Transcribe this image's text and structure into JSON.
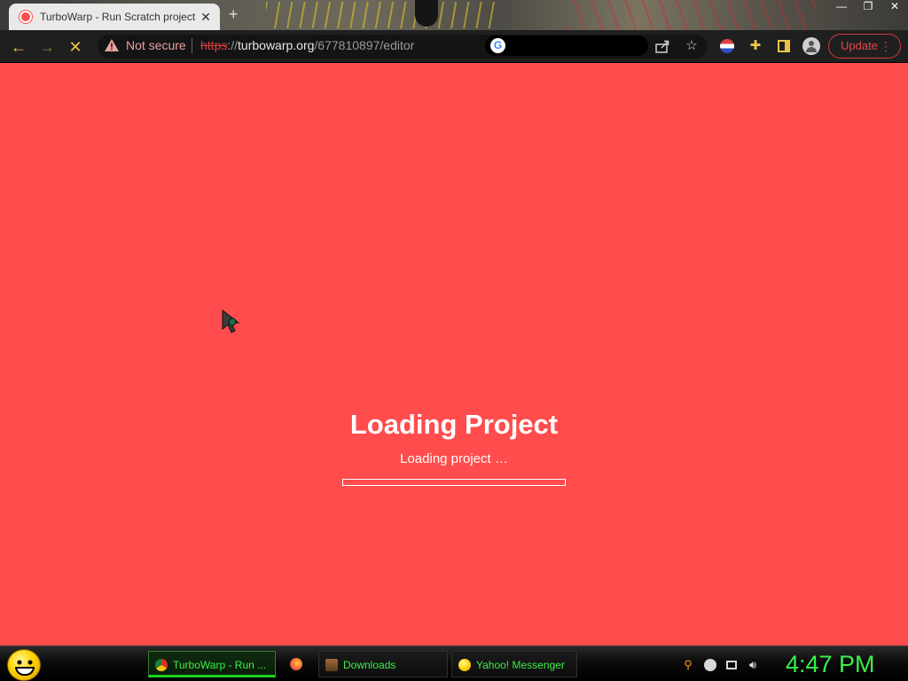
{
  "browser": {
    "tab_title": "TurboWarp - Run Scratch project",
    "tab_close": "✕",
    "new_tab": "+",
    "security_label": "Not secure",
    "url": {
      "protocol": "https",
      "separator": "://",
      "host": "turbowarp.org",
      "path": "/677810897/editor"
    },
    "update_label": "Update",
    "window_controls": [
      "—",
      "❐",
      "✕"
    ]
  },
  "page": {
    "background_color": "#ff4c4c",
    "loading_title": "Loading Project",
    "loading_status": "Loading project …",
    "progress_fraction": 0
  },
  "taskbar": {
    "items": [
      {
        "label": "TurboWarp - Run ...",
        "icon": "chrome-icon",
        "active": true
      },
      {
        "label": "",
        "icon": "firefox-icon",
        "active": false
      },
      {
        "label": "Downloads",
        "icon": "folder-icon",
        "active": false
      },
      {
        "label": "Yahoo! Messenger",
        "icon": "yahoo-messenger-icon",
        "active": false
      }
    ],
    "clock": "4:47 PM"
  }
}
